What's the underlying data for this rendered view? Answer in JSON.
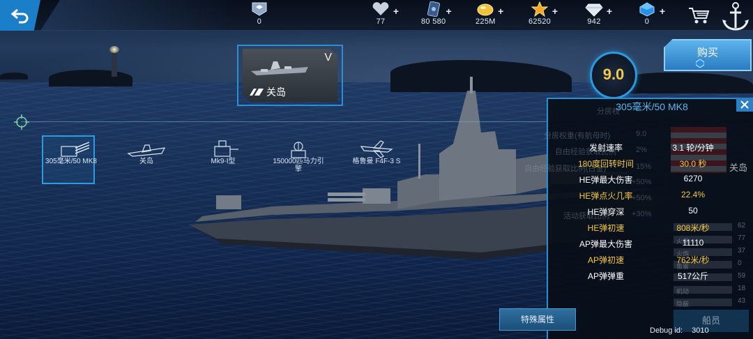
{
  "resources": [
    {
      "icon": "rank-badge-icon",
      "value": "0",
      "plus": false
    },
    {
      "icon": "heart-icon",
      "value": "77",
      "plus": true
    },
    {
      "icon": "card-icon",
      "value": "80 580",
      "plus": true
    },
    {
      "icon": "gold-coin-icon",
      "value": "225M",
      "plus": true
    },
    {
      "icon": "star-icon",
      "value": "62520",
      "plus": true
    },
    {
      "icon": "diamond-icon",
      "value": "942",
      "plus": true
    },
    {
      "icon": "blue-gem-icon",
      "value": "0",
      "plus": true
    }
  ],
  "ship_card": {
    "name": "关岛",
    "tier": "V"
  },
  "score": "9.0",
  "buy_label": "购买",
  "modules": [
    {
      "label": "305毫米/50 MK8",
      "selected": true
    },
    {
      "label": "关岛",
      "selected": false
    },
    {
      "label": "Mk9-I型",
      "selected": false
    },
    {
      "label": "150000匹马力引擎",
      "selected": false
    },
    {
      "label": "格鲁曼 F4F-3 S",
      "selected": false
    }
  ],
  "panel": {
    "title": "305毫米/50 MK8",
    "ghost_rows": [
      {
        "label": "分房权",
        "value": ""
      },
      {
        "label": "分房权重(有航母时)",
        "value": "9.0"
      },
      {
        "label": "自由经验获取比例",
        "value": "2%"
      },
      {
        "label": "自由经验获取比例(白金)",
        "value": "15%"
      },
      {
        "label": "",
        "value": "+50%"
      },
      {
        "label": "",
        "value": "+50%"
      },
      {
        "label": "活动获取比例",
        "value": "+30%"
      }
    ],
    "stats": [
      {
        "name": "发射速率",
        "value": "3.1 轮/分钟",
        "highlight": false
      },
      {
        "name": "180度回转时间",
        "value": "30.0 秒",
        "highlight": true
      },
      {
        "name": "HE弹最大伤害",
        "value": "6270",
        "highlight": false
      },
      {
        "name": "HE弹点火几率",
        "value": "22.4%",
        "highlight": true
      },
      {
        "name": "HE弹穿深",
        "value": "50",
        "highlight": false
      },
      {
        "name": "HE弹初速",
        "value": "808米/秒",
        "highlight": true
      },
      {
        "name": "AP弹最大伤害",
        "value": "11110",
        "highlight": false
      },
      {
        "name": "AP弹初速",
        "value": "762米/秒",
        "highlight": true
      },
      {
        "name": "AP弹弹重",
        "value": "517公斤",
        "highlight": false
      }
    ],
    "side_values": [
      "62",
      "77",
      "37",
      "0",
      "59",
      "18",
      "43"
    ],
    "side_labels": [
      "火炮",
      "火炮",
      "鱼雷",
      "机动",
      "隐蔽"
    ],
    "flag_name": "关岛",
    "crew_label": "船员"
  },
  "special_button": "特殊属性",
  "debug": {
    "label": "Debug id:",
    "value": "3010"
  },
  "colors": {
    "accent": "#2a8fd6",
    "highlight": "#f5c842",
    "score": "#f7c84a"
  }
}
